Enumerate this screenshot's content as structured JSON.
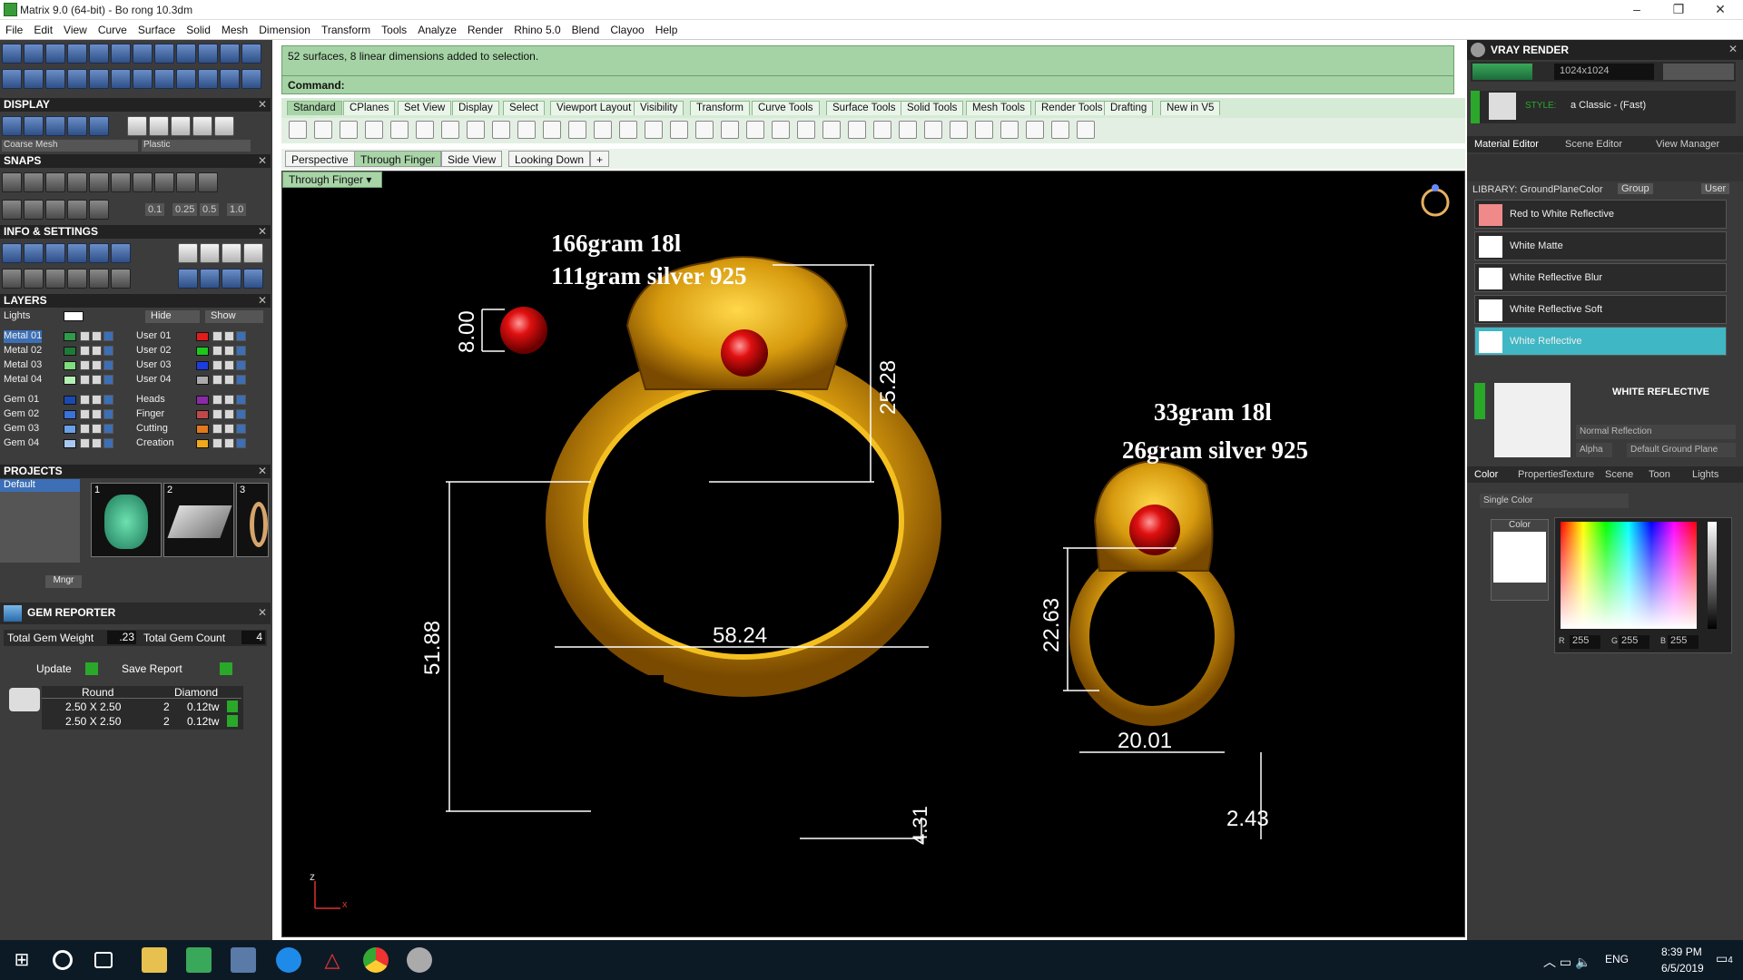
{
  "window": {
    "title": "Matrix 9.0 (64-bit) - Bo rong 10.3dm"
  },
  "menu": [
    "File",
    "Edit",
    "View",
    "Curve",
    "Surface",
    "Solid",
    "Mesh",
    "Dimension",
    "Transform",
    "Tools",
    "Analyze",
    "Render",
    "Rhino 5.0",
    "Blend",
    "Clayoo",
    "Help"
  ],
  "left": {
    "display": {
      "title": "DISPLAY",
      "mesh_select": "Coarse Mesh",
      "material_select": "Plastic"
    },
    "snaps": {
      "title": "SNAPS",
      "values": [
        "0.1",
        "0.25",
        "0.5",
        "1.0"
      ]
    },
    "info_title": "INFO & SETTINGS",
    "layers": {
      "title": "LAYERS",
      "lights": "Lights",
      "hide": "Hide",
      "show": "Show",
      "left_col": [
        {
          "name": "Metal 01",
          "color": "#2f9a4a"
        },
        {
          "name": "Metal 02",
          "color": "#1e7a38"
        },
        {
          "name": "Metal 03",
          "color": "#7ddc7d"
        },
        {
          "name": "Metal 04",
          "color": "#b4f0b4"
        },
        {
          "name": "Gem 01",
          "color": "#1a4ab0"
        },
        {
          "name": "Gem 02",
          "color": "#3a72d8"
        },
        {
          "name": "Gem 03",
          "color": "#6aa0e8"
        },
        {
          "name": "Gem 04",
          "color": "#a8c8f0"
        }
      ],
      "right_col": [
        {
          "name": "User 01",
          "color": "#e01c1c"
        },
        {
          "name": "User 02",
          "color": "#1cc81c"
        },
        {
          "name": "User 03",
          "color": "#1c3ce0"
        },
        {
          "name": "User 04",
          "color": "#aaaaaa"
        },
        {
          "name": "Heads",
          "color": "#8a2aa8"
        },
        {
          "name": "Finger",
          "color": "#c04848"
        },
        {
          "name": "Cutting",
          "color": "#e07a1c"
        },
        {
          "name": "Creation",
          "color": "#f0a81c"
        }
      ]
    },
    "projects": {
      "title": "PROJECTS",
      "list": [
        "Default"
      ],
      "thumb_numbers": [
        "1",
        "2",
        "3"
      ],
      "mngr": "Mngr"
    },
    "gem_reporter": {
      "title": "GEM REPORTER",
      "total_weight_label": "Total Gem Weight",
      "total_weight": ".23",
      "total_count_label": "Total Gem Count",
      "total_count": "4",
      "update": "Update",
      "save_report": "Save Report",
      "col_shape": "Round",
      "col_type": "Diamond",
      "rows": [
        {
          "size": "2.50 X 2.50",
          "qty": "2",
          "tw": "0.12tw"
        },
        {
          "size": "2.50 X 2.50",
          "qty": "2",
          "tw": "0.12tw"
        }
      ]
    }
  },
  "command": {
    "status": "52 surfaces, 8 linear dimensions added to selection.",
    "prompt": "Command:"
  },
  "toolbar_tabs": [
    "Standard",
    "CPlanes",
    "Set View",
    "Display",
    "Select",
    "Viewport Layout",
    "Visibility",
    "Transform",
    "Curve Tools",
    "Surface Tools",
    "Solid Tools",
    "Mesh Tools",
    "Render Tools",
    "Drafting",
    "New in V5"
  ],
  "viewport_tabs": [
    "Perspective",
    "Through Finger",
    "Side View",
    "Looking Down"
  ],
  "viewport_active_tab": "Through Finger",
  "viewport_title": "Through Finger",
  "annotations": {
    "bangle_weights": [
      "166gram 18l",
      "111gram silver 925"
    ],
    "ring_weights": [
      "33gram 18l",
      "26gram silver 925"
    ],
    "dims": {
      "gem": "8.00",
      "head_height": "25.28",
      "bangle_width": "58.24",
      "bangle_height": "51.88",
      "band": "4.31",
      "ring_height": "22.63",
      "ring_width": "20.01",
      "ring_band": "2.43"
    },
    "axis_z": "z",
    "axis_x": "x"
  },
  "right": {
    "vray_title": "VRAY RENDER",
    "resolution": "1024x1024",
    "style_label": "STYLE:",
    "style_value": "a Classic - (Fast)",
    "tabs": [
      "Material Editor",
      "Scene Editor",
      "View Manager"
    ],
    "library_label": "LIBRARY: GroundPlaneColor",
    "library_group": "Group",
    "library_user": "User",
    "materials": [
      "Red to White Reflective",
      "White Matte",
      "White Reflective Blur",
      "White Reflective Soft",
      "White Reflective"
    ],
    "selected_material": "White Reflective",
    "preview_title": "WHITE REFLECTIVE",
    "reflection": "Normal Reflection",
    "alpha": "Alpha",
    "ground": "Default Ground Plane",
    "prop_tabs": [
      "Color",
      "Properties",
      "Texture",
      "Scene",
      "Toon",
      "Lights"
    ],
    "color_mode": "Single Color",
    "color_label": "Color",
    "r_label": "R",
    "r": "255",
    "g_label": "G",
    "g": "255",
    "b_label": "B",
    "b": "255",
    "accent": "#3fb7c4"
  },
  "taskbar": {
    "lang": "ENG",
    "time": "8:39 PM",
    "date": "6/5/2019",
    "notif_count": "4"
  }
}
